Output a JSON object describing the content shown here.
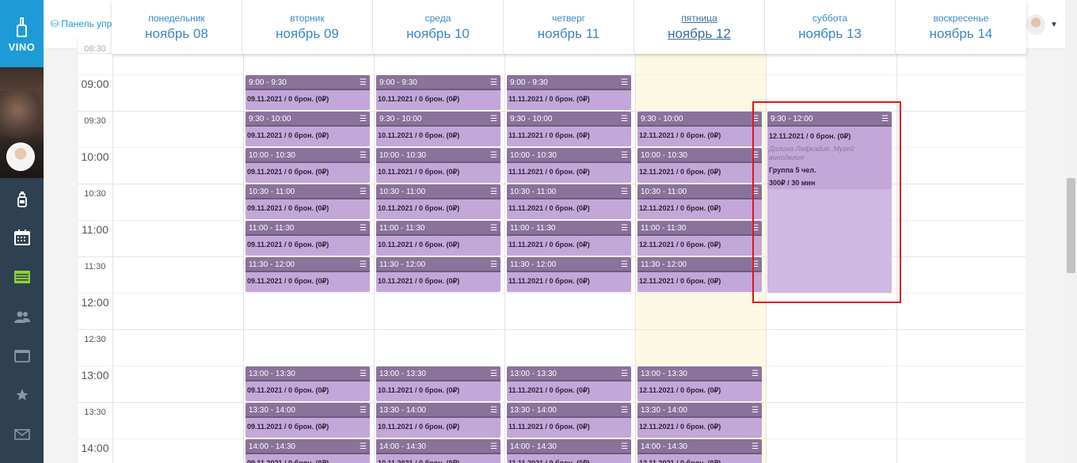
{
  "sidebar": {
    "logo_text": "VINO",
    "icons": [
      "bottle-icon",
      "calendar-icon",
      "list-icon",
      "users-icon",
      "window-icon",
      "star-icon",
      "mail-icon"
    ]
  },
  "topbar": {
    "panel_link": "Панель упр"
  },
  "week": {
    "days": [
      {
        "name": "понедельник",
        "date": "ноябрь 08"
      },
      {
        "name": "вторник",
        "date": "ноябрь 09"
      },
      {
        "name": "среда",
        "date": "ноябрь 10"
      },
      {
        "name": "четверг",
        "date": "ноябрь 11"
      },
      {
        "name": "пятница",
        "date": "ноябрь 12"
      },
      {
        "name": "суббота",
        "date": "ноябрь 13"
      },
      {
        "name": "воскресенье",
        "date": "ноябрь 14"
      }
    ],
    "today_index": 4
  },
  "times": [
    "08:30",
    "09:00",
    "09:30",
    "10:00",
    "10:30",
    "11:00",
    "11:30",
    "12:00",
    "12:30",
    "13:00",
    "13:30",
    "14:00"
  ],
  "events": {
    "tue": {
      "date_line": "09.11.2021 / 0 брон. (0₽)"
    },
    "wed": {
      "date_line": "10.11.2021 / 0 брон. (0₽)"
    },
    "thu": {
      "date_line": "11.11.2021 / 0 брон. (0₽)"
    },
    "fri": {
      "date_line": "12.11.2021 / 0 брон. (0₽)"
    },
    "slots": [
      "9:00 - 9:30",
      "9:30 - 10:00",
      "10:00 - 10:30",
      "10:30 - 11:00",
      "11:00 - 11:30",
      "11:30 - 12:00",
      "13:00 - 13:30",
      "13:30 - 14:00",
      "14:00 - 14:30"
    ]
  },
  "sat_event": {
    "time": "9:30 - 12:00",
    "date_line": "12.11.2021 / 0 брон. (0₽)",
    "location": "Долина Лефкадия. Музей виноделия",
    "group": "Группа 5 чел.",
    "price": "300₽ / 30 мин"
  }
}
